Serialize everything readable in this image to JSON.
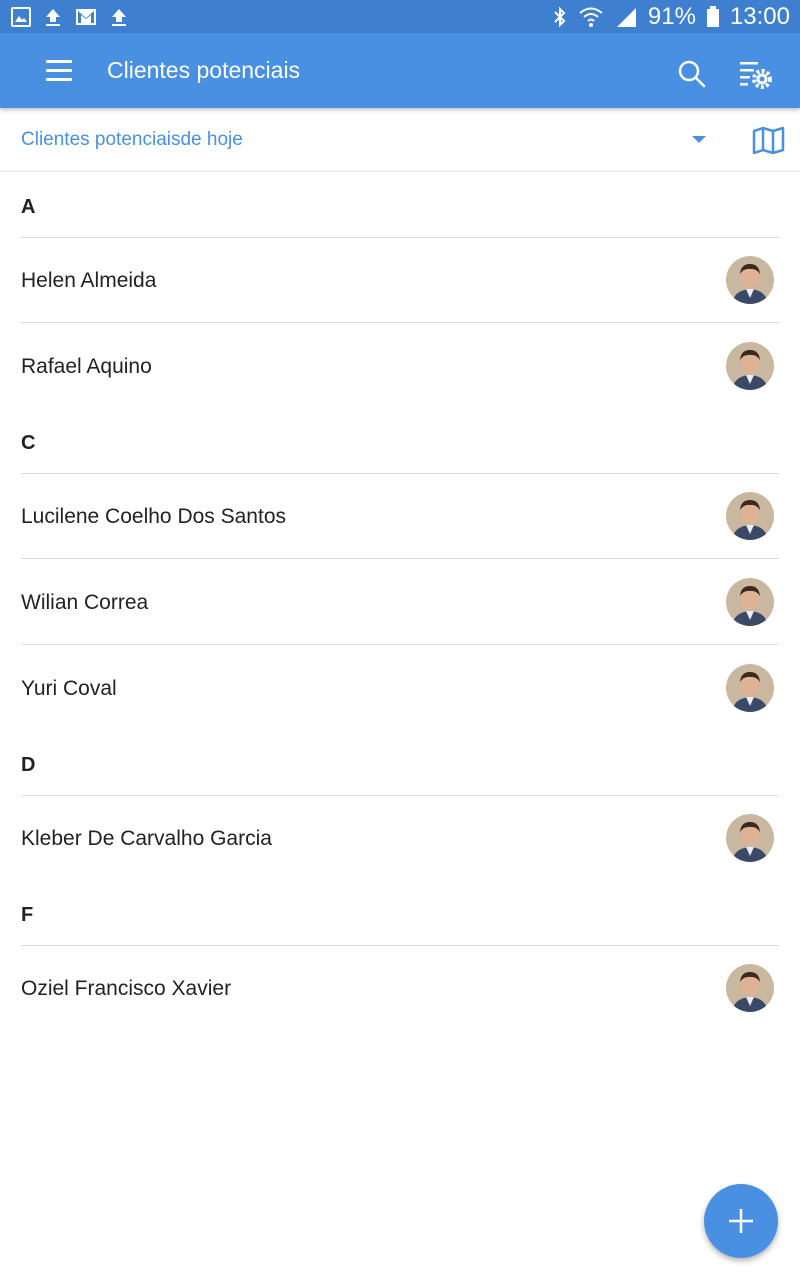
{
  "status_bar": {
    "battery": "91%",
    "time": "13:00",
    "icons": [
      "image-icon",
      "upload-icon",
      "gmail-icon",
      "upload-icon",
      "bluetooth-icon",
      "wifi-icon",
      "signal-icon",
      "battery-icon"
    ]
  },
  "app_bar": {
    "title": "Clientes potenciais",
    "icons": [
      "menu-icon",
      "search-icon",
      "filter-settings-icon"
    ]
  },
  "filter": {
    "label": "Clientes potenciaisde hoje",
    "icons": [
      "dropdown-arrow-icon",
      "map-icon"
    ]
  },
  "sections": [
    {
      "letter": "A",
      "contacts": [
        "Helen Almeida",
        "Rafael Aquino"
      ]
    },
    {
      "letter": "C",
      "contacts": [
        "Lucilene Coelho Dos Santos",
        "Wilian Correa",
        "Yuri Coval"
      ]
    },
    {
      "letter": "D",
      "contacts": [
        "Kleber De Carvalho Garcia"
      ]
    },
    {
      "letter": "F",
      "contacts": [
        "Oziel Francisco Xavier"
      ]
    }
  ],
  "fab": {
    "icon": "plus-icon"
  },
  "colors": {
    "status_bar": "#3f7fd0",
    "primary": "#4a90e2",
    "divider": "#dcdcdc",
    "text": "#222222"
  }
}
